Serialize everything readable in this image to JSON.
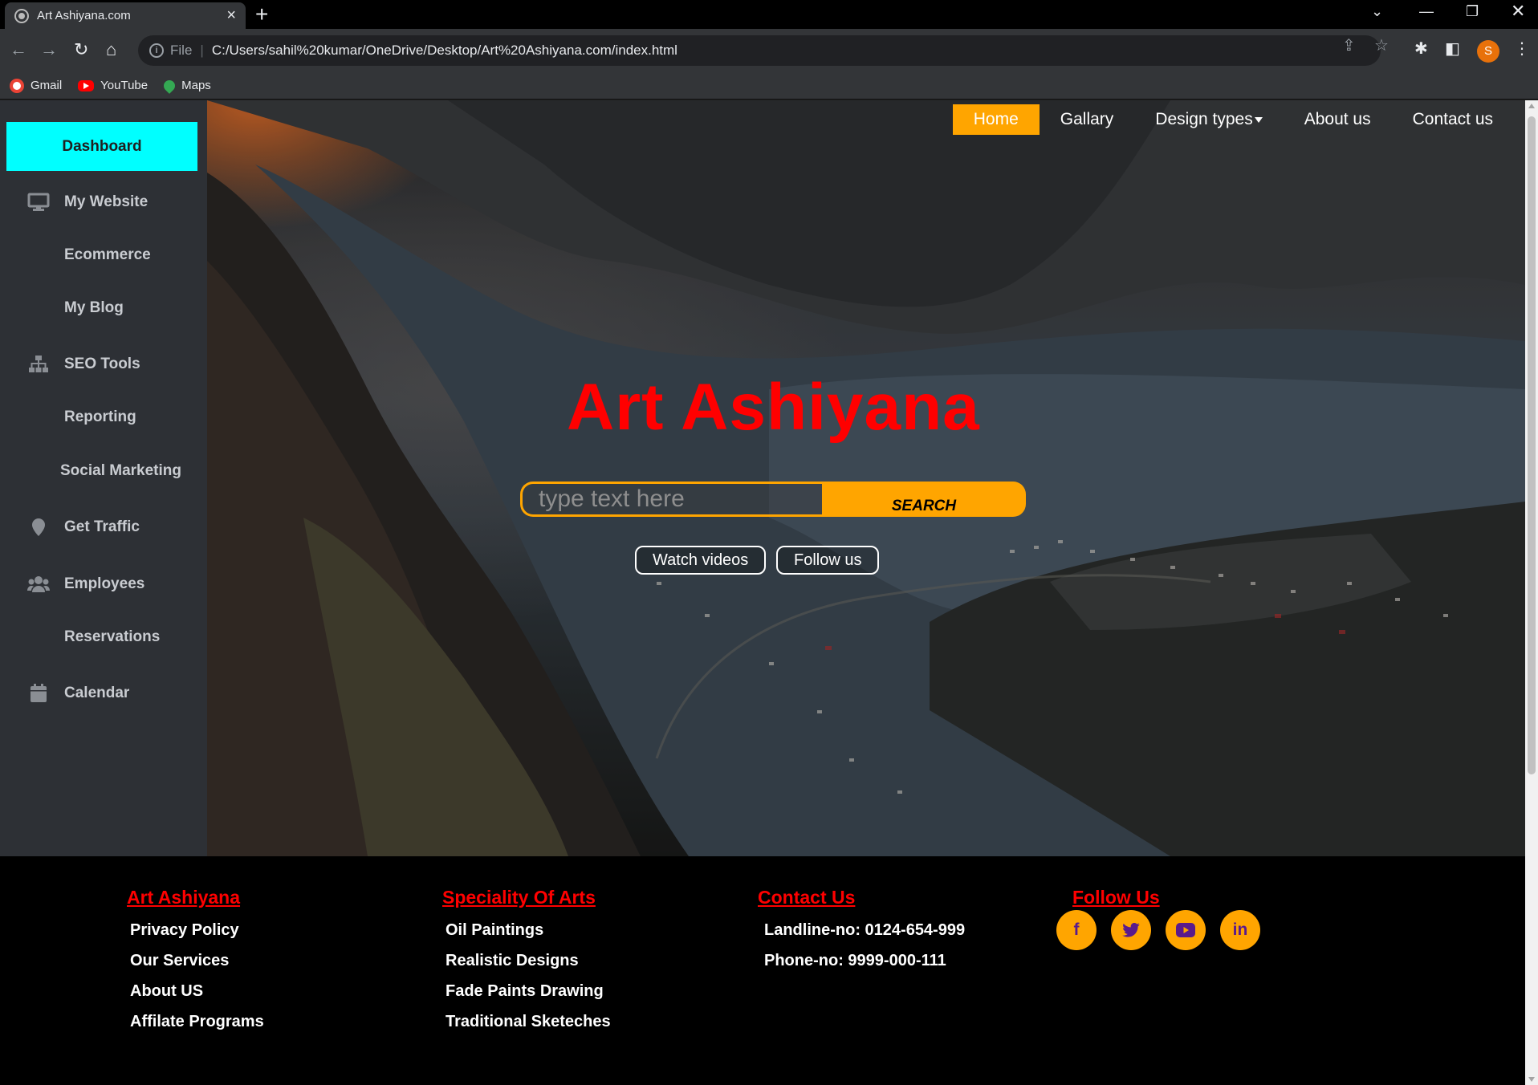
{
  "browser": {
    "tab_title": "Art Ashiyana.com",
    "new_tab": "+",
    "file_label": "File",
    "url": "C:/Users/sahil%20kumar/OneDrive/Desktop/Art%20Ashiyana.com/index.html",
    "profile_initial": "S",
    "bookmarks": [
      {
        "label": "Gmail",
        "icon": "gmail-icon"
      },
      {
        "label": "YouTube",
        "icon": "youtube-icon"
      },
      {
        "label": "Maps",
        "icon": "maps-icon"
      }
    ]
  },
  "sidebar": {
    "dashboard_label": "Dashboard",
    "accent_color": "#00ffff",
    "items": [
      {
        "label": "My Website",
        "icon": "monitor-icon"
      },
      {
        "label": "Ecommerce",
        "icon": ""
      },
      {
        "label": "My Blog",
        "icon": ""
      },
      {
        "label": "SEO Tools",
        "icon": "sitemap-icon"
      },
      {
        "label": "Reporting",
        "icon": ""
      },
      {
        "label": "Social Marketing",
        "icon": ""
      },
      {
        "label": "Get Traffic",
        "icon": "map-pin-icon"
      },
      {
        "label": "Employees",
        "icon": "users-icon"
      },
      {
        "label": "Reservations",
        "icon": ""
      },
      {
        "label": "Calendar",
        "icon": "calendar-icon"
      }
    ]
  },
  "nav": {
    "items": [
      "Home",
      "Gallary",
      "Design types",
      "About us",
      "Contact us"
    ],
    "active": "Home",
    "active_color": "#ffa500"
  },
  "hero": {
    "title": "Art Ashiyana",
    "title_color": "#ff0000",
    "search_placeholder": "type text here",
    "search_button": "SEARCH",
    "watch_button": "Watch videos",
    "follow_button": "Follow us"
  },
  "footer": {
    "col1": {
      "heading": "Art Ashiyana",
      "items": [
        "Privacy Policy",
        "Our Services",
        "About US",
        "Affilate Programs"
      ]
    },
    "col2": {
      "heading": "Speciality Of Arts",
      "items": [
        "Oil Paintings",
        "Realistic Designs",
        "Fade Paints Drawing",
        "Traditional Sketeches"
      ]
    },
    "col3": {
      "heading": "Contact Us",
      "items": [
        "Landline-no: 0124-654-999",
        "Phone-no: 9999-000-111"
      ]
    },
    "col4": {
      "heading": "Follow Us",
      "social": [
        {
          "glyph": "f",
          "icon": "facebook-icon"
        },
        {
          "glyph": "❧",
          "icon": "twitter-icon"
        },
        {
          "glyph": "▶",
          "icon": "youtube-icon"
        },
        {
          "glyph": "in",
          "icon": "linkedin-icon"
        }
      ]
    }
  }
}
